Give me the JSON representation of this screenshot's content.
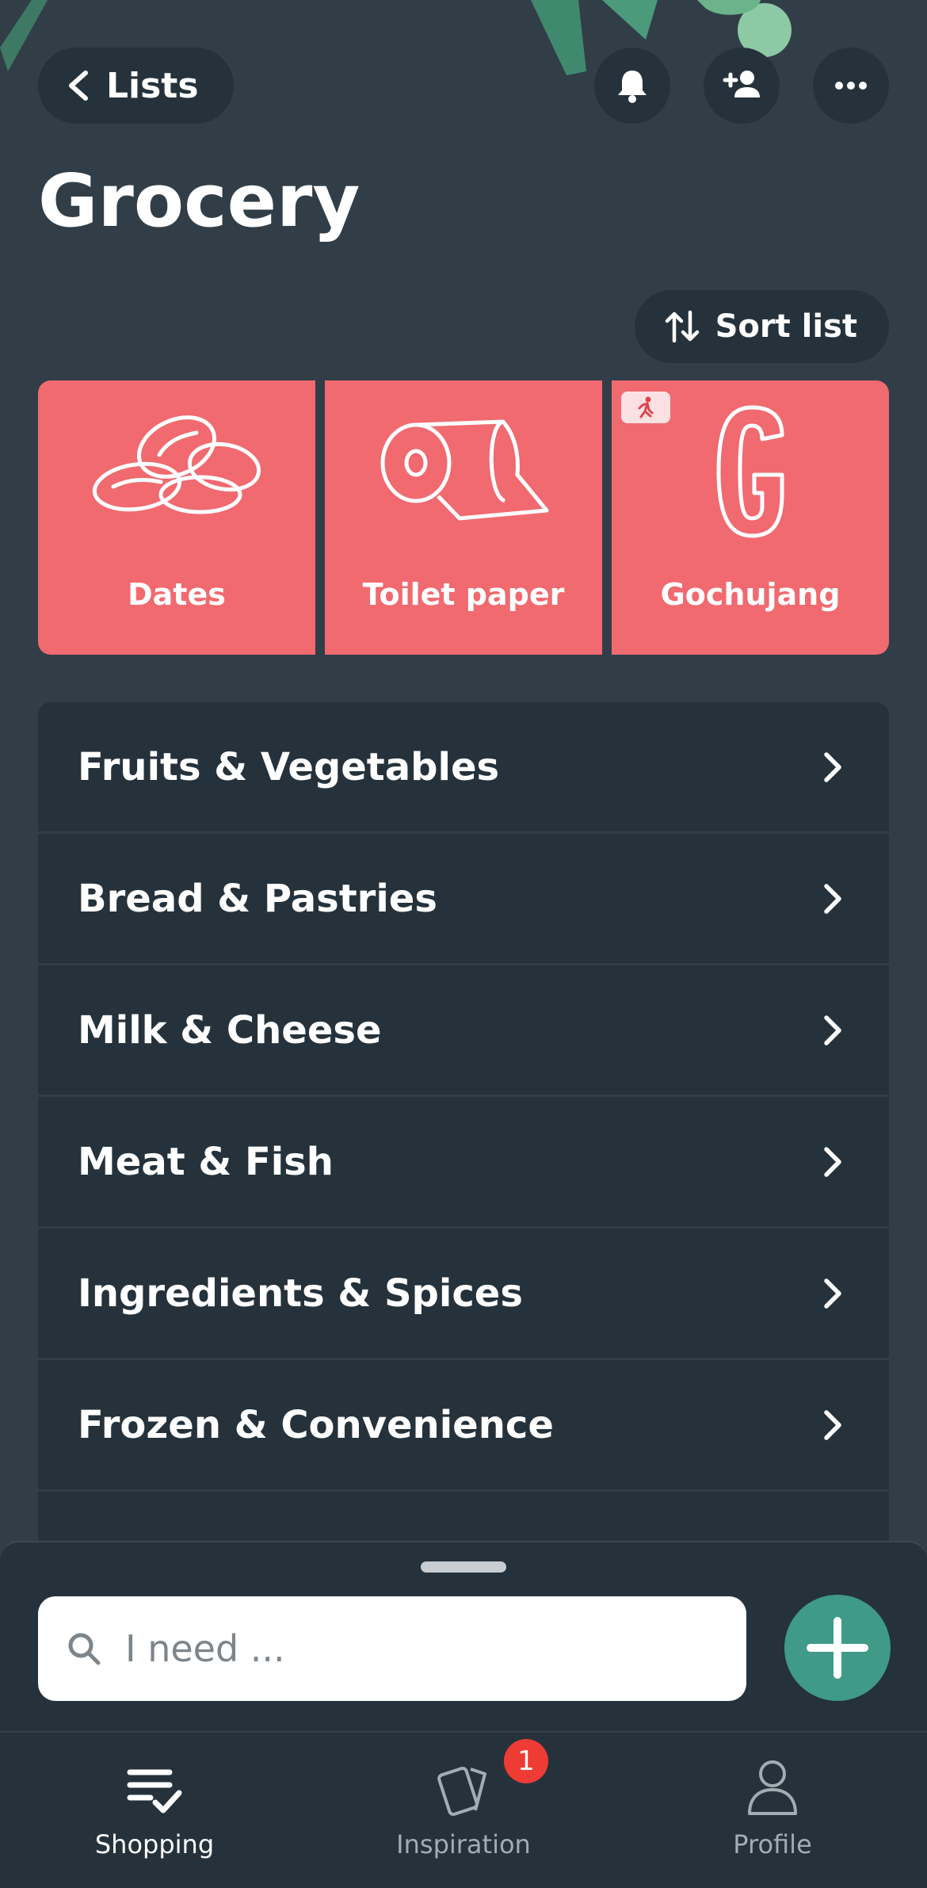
{
  "colors": {
    "background": "#323e47",
    "surface": "#25323b",
    "tile": "#f06a70",
    "accent": "#3f9a88",
    "badge": "#ee3b34"
  },
  "header": {
    "back_label": "Lists",
    "title": "Grocery",
    "icons": [
      "bell-icon",
      "add-user-icon",
      "more-icon"
    ]
  },
  "sort": {
    "label": "Sort list"
  },
  "tiles": [
    {
      "label": "Dates",
      "icon": "dates-icon"
    },
    {
      "label": "Toilet paper",
      "icon": "toilet-paper-icon"
    },
    {
      "label": "Gochujang",
      "icon": "letter-g-icon",
      "badge_icon": "running-person-icon"
    }
  ],
  "categories": [
    {
      "label": "Fruits & Vegetables"
    },
    {
      "label": "Bread & Pastries"
    },
    {
      "label": "Milk & Cheese"
    },
    {
      "label": "Meat & Fish"
    },
    {
      "label": "Ingredients & Spices"
    },
    {
      "label": "Frozen & Convenience"
    }
  ],
  "search": {
    "placeholder": "I need ...",
    "value": ""
  },
  "tabbar": {
    "tabs": [
      {
        "label": "Shopping",
        "icon": "shopping-list-icon",
        "active": true
      },
      {
        "label": "Inspiration",
        "icon": "cards-icon",
        "badge": "1"
      },
      {
        "label": "Profile",
        "icon": "profile-icon"
      }
    ]
  }
}
